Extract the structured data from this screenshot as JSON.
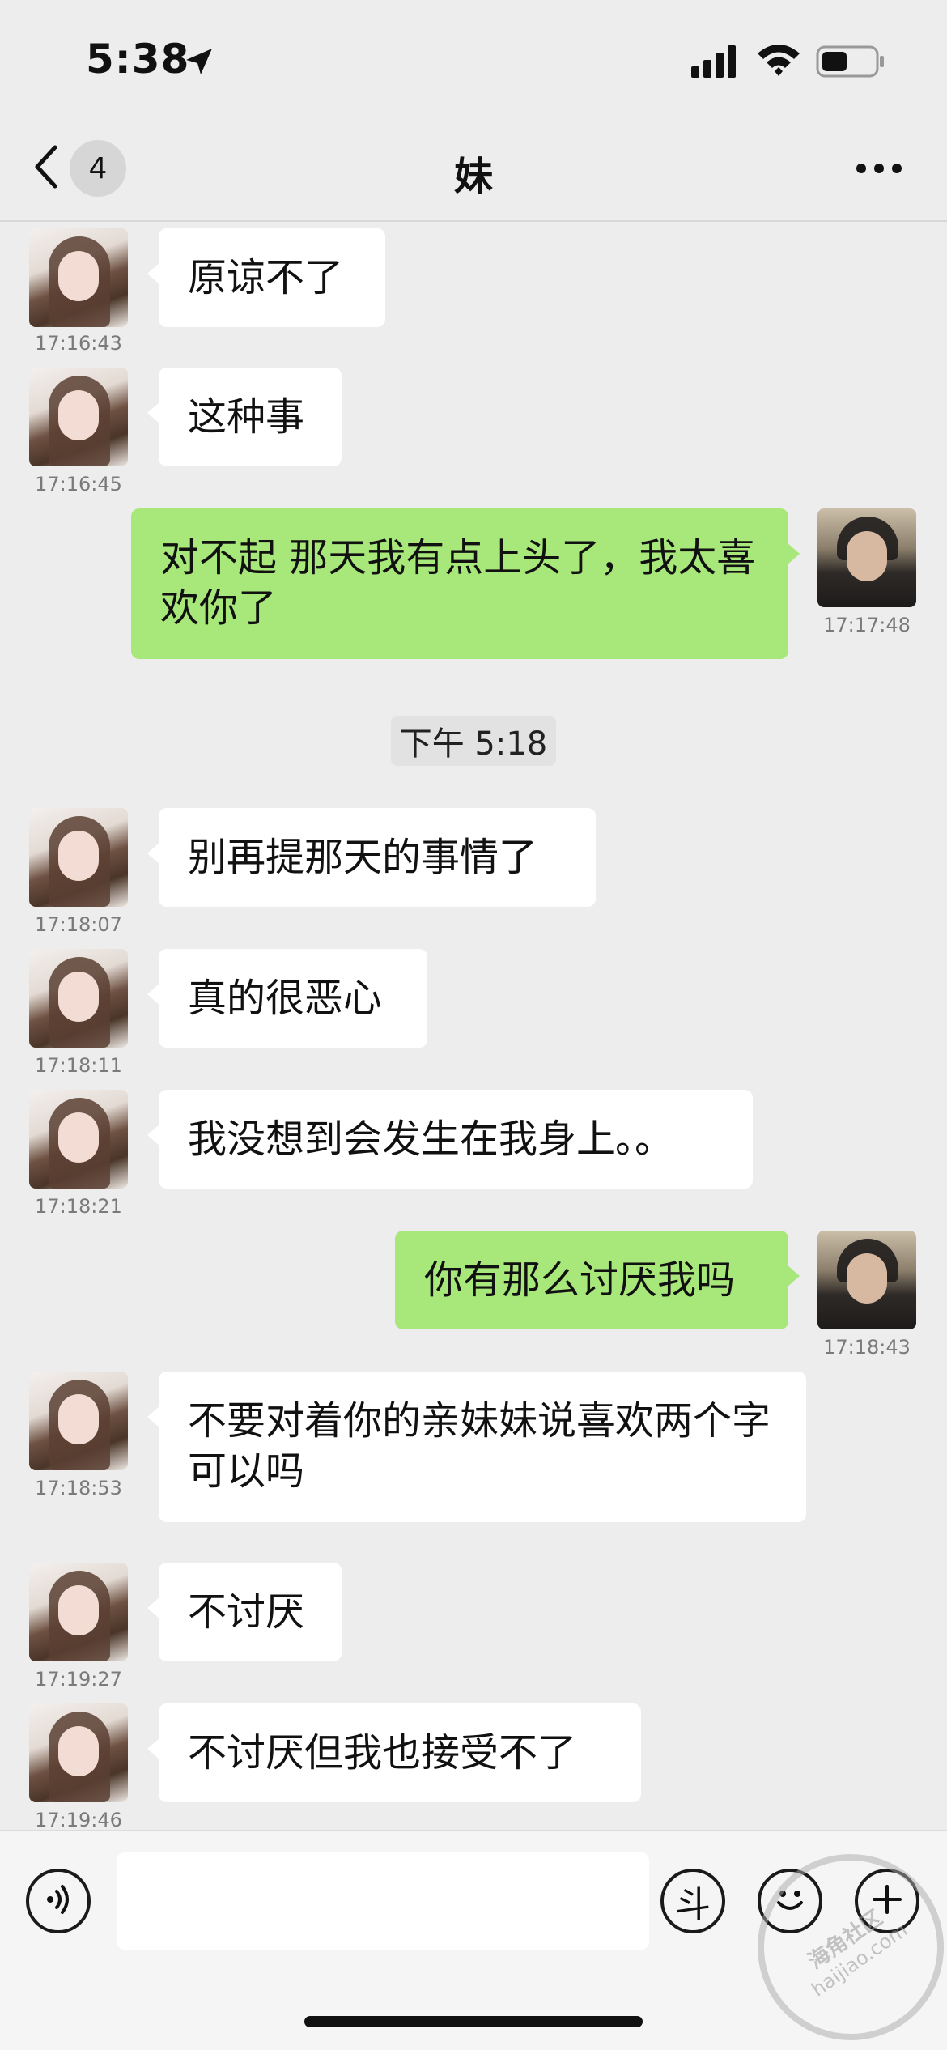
{
  "status_bar": {
    "time": "5:38"
  },
  "nav": {
    "back_count": "4",
    "title": "妹"
  },
  "divider": {
    "text": "下午 5:18"
  },
  "messages": [
    {
      "sender": "her",
      "text": "原谅不了",
      "time": "17:16:43"
    },
    {
      "sender": "her",
      "text": "这种事",
      "time": "17:16:45"
    },
    {
      "sender": "me",
      "text": "对不起 那天我有点上头了，我太喜欢你了",
      "time": "17:17:48"
    },
    {
      "sender": "her",
      "text": "别再提那天的事情了",
      "time": "17:18:07"
    },
    {
      "sender": "her",
      "text": "真的很恶心",
      "time": "17:18:11"
    },
    {
      "sender": "her",
      "text": "我没想到会发生在我身上。。",
      "time": "17:18:21"
    },
    {
      "sender": "me",
      "text": "你有那么讨厌我吗",
      "time": "17:18:43"
    },
    {
      "sender": "her",
      "text": "不要对着你的亲妹妹说喜欢两个字可以吗",
      "time": "17:18:53"
    },
    {
      "sender": "her",
      "text": "不讨厌",
      "time": "17:19:27"
    },
    {
      "sender": "her",
      "text": "不讨厌但我也接受不了",
      "time": "17:19:46"
    }
  ],
  "input_bar": {
    "value": "",
    "sticker_label": "斗"
  },
  "watermark": {
    "line1": "海角社区",
    "line2": "haijiao.com"
  },
  "colors": {
    "background": "#ededed",
    "incoming_bubble": "#ffffff",
    "outgoing_bubble": "#a8e77a"
  }
}
